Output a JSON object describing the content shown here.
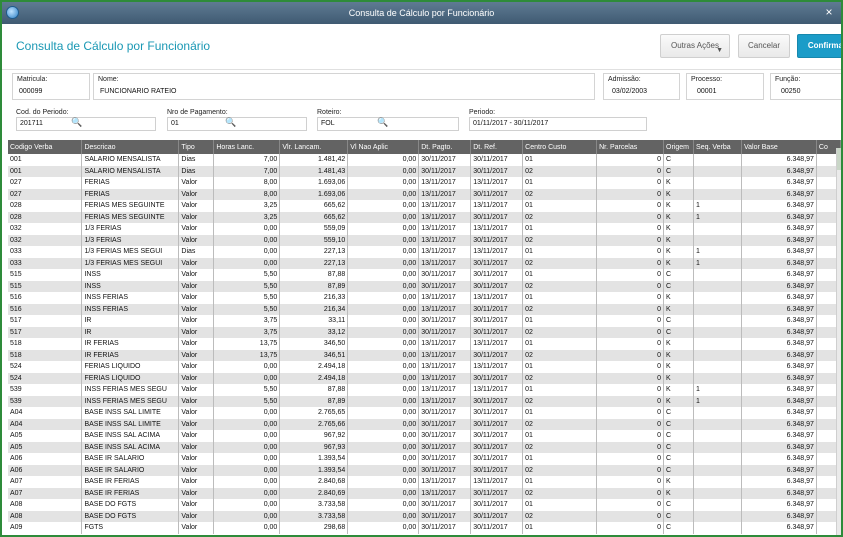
{
  "window": {
    "title": "Consulta de Cálculo por Funcionário"
  },
  "header": {
    "title": "Consulta de Cálculo por Funcionário",
    "buttons": {
      "outras": "Outras Ações",
      "cancelar": "Cancelar",
      "confirmar": "Confirmar"
    }
  },
  "employee": {
    "matricula": {
      "label": "Matricula:",
      "value": "000099"
    },
    "nome": {
      "label": "Nome:",
      "value": "FUNCIONARIO RATEIO"
    },
    "admissao": {
      "label": "Admissão:",
      "value": "03/02/2003"
    },
    "processo": {
      "label": "Processo:",
      "value": "00001"
    },
    "funcao": {
      "label": "Função:",
      "value": "00250"
    }
  },
  "filters": {
    "cod_periodo": {
      "label": "Cod. do Periodo:",
      "value": "201711"
    },
    "nro_pagamento": {
      "label": "Nro de Pagamento:",
      "value": "01"
    },
    "roteiro": {
      "label": "Roteiro:",
      "value": "FOL"
    },
    "periodo": {
      "label": "Periodo:",
      "value": "01/11/2017 - 30/11/2017"
    }
  },
  "table": {
    "columns": [
      "Codigo Verba",
      "Descricao",
      "Tipo",
      "Horas Lanc.",
      "Vlr. Lancam.",
      "Vl Nao Aplic",
      "Dt. Pagto.",
      "Dt. Ref.",
      "Centro Custo",
      "Nr. Parcelas",
      "Origem",
      "Seq. Verba",
      "Valor Base",
      "Co"
    ],
    "rows": [
      [
        "001",
        "SALARIO MENSALISTA",
        "Dias",
        "7,00",
        "1.481,42",
        "0,00",
        "30/11/2017",
        "30/11/2017",
        "01",
        "0",
        "C",
        "",
        "6.348,97"
      ],
      [
        "001",
        "SALARIO MENSALISTA",
        "Dias",
        "7,00",
        "1.481,43",
        "0,00",
        "30/11/2017",
        "30/11/2017",
        "02",
        "0",
        "C",
        "",
        "6.348,97"
      ],
      [
        "027",
        "FERIAS",
        "Valor",
        "8,00",
        "1.693,06",
        "0,00",
        "13/11/2017",
        "13/11/2017",
        "01",
        "0",
        "K",
        "",
        "6.348,97"
      ],
      [
        "027",
        "FERIAS",
        "Valor",
        "8,00",
        "1.693,06",
        "0,00",
        "13/11/2017",
        "30/11/2017",
        "02",
        "0",
        "K",
        "",
        "6.348,97"
      ],
      [
        "028",
        "FERIAS MES SEGUINTE",
        "Valor",
        "3,25",
        "665,62",
        "0,00",
        "13/11/2017",
        "13/11/2017",
        "01",
        "0",
        "K",
        "1",
        "6.348,97"
      ],
      [
        "028",
        "FERIAS MES SEGUINTE",
        "Valor",
        "3,25",
        "665,62",
        "0,00",
        "13/11/2017",
        "30/11/2017",
        "02",
        "0",
        "K",
        "1",
        "6.348,97"
      ],
      [
        "032",
        "1/3 FERIAS",
        "Valor",
        "0,00",
        "559,09",
        "0,00",
        "13/11/2017",
        "13/11/2017",
        "01",
        "0",
        "K",
        "",
        "6.348,97"
      ],
      [
        "032",
        "1/3 FERIAS",
        "Valor",
        "0,00",
        "559,10",
        "0,00",
        "13/11/2017",
        "30/11/2017",
        "02",
        "0",
        "K",
        "",
        "6.348,97"
      ],
      [
        "033",
        "1/3 FERIAS MES SEGUI",
        "Dias",
        "0,00",
        "227,13",
        "0,00",
        "13/11/2017",
        "13/11/2017",
        "01",
        "0",
        "K",
        "1",
        "6.348,97"
      ],
      [
        "033",
        "1/3 FERIAS MES SEGUI",
        "Valor",
        "0,00",
        "227,13",
        "0,00",
        "13/11/2017",
        "30/11/2017",
        "02",
        "0",
        "K",
        "1",
        "6.348,97"
      ],
      [
        "515",
        "INSS",
        "Valor",
        "5,50",
        "87,88",
        "0,00",
        "30/11/2017",
        "30/11/2017",
        "01",
        "0",
        "C",
        "",
        "6.348,97"
      ],
      [
        "515",
        "INSS",
        "Valor",
        "5,50",
        "87,89",
        "0,00",
        "30/11/2017",
        "30/11/2017",
        "02",
        "0",
        "C",
        "",
        "6.348,97"
      ],
      [
        "516",
        "INSS FERIAS",
        "Valor",
        "5,50",
        "216,33",
        "0,00",
        "13/11/2017",
        "13/11/2017",
        "01",
        "0",
        "K",
        "",
        "6.348,97"
      ],
      [
        "516",
        "INSS FERIAS",
        "Valor",
        "5,50",
        "216,34",
        "0,00",
        "13/11/2017",
        "30/11/2017",
        "02",
        "0",
        "K",
        "",
        "6.348,97"
      ],
      [
        "517",
        "IR",
        "Valor",
        "3,75",
        "33,11",
        "0,00",
        "30/11/2017",
        "30/11/2017",
        "01",
        "0",
        "C",
        "",
        "6.348,97"
      ],
      [
        "517",
        "IR",
        "Valor",
        "3,75",
        "33,12",
        "0,00",
        "30/11/2017",
        "30/11/2017",
        "02",
        "0",
        "C",
        "",
        "6.348,97"
      ],
      [
        "518",
        "IR FERIAS",
        "Valor",
        "13,75",
        "346,50",
        "0,00",
        "13/11/2017",
        "13/11/2017",
        "01",
        "0",
        "K",
        "",
        "6.348,97"
      ],
      [
        "518",
        "IR FERIAS",
        "Valor",
        "13,75",
        "346,51",
        "0,00",
        "13/11/2017",
        "30/11/2017",
        "02",
        "0",
        "K",
        "",
        "6.348,97"
      ],
      [
        "524",
        "FERIAS LIQUIDO",
        "Valor",
        "0,00",
        "2.494,18",
        "0,00",
        "13/11/2017",
        "13/11/2017",
        "01",
        "0",
        "K",
        "",
        "6.348,97"
      ],
      [
        "524",
        "FERIAS LIQUIDO",
        "Valor",
        "0,00",
        "2.494,18",
        "0,00",
        "13/11/2017",
        "30/11/2017",
        "02",
        "0",
        "K",
        "",
        "6.348,97"
      ],
      [
        "539",
        "INSS FERIAS MES SEGU",
        "Valor",
        "5,50",
        "87,88",
        "0,00",
        "13/11/2017",
        "13/11/2017",
        "01",
        "0",
        "K",
        "1",
        "6.348,97"
      ],
      [
        "539",
        "INSS FERIAS MES SEGU",
        "Valor",
        "5,50",
        "87,89",
        "0,00",
        "13/11/2017",
        "30/11/2017",
        "02",
        "0",
        "K",
        "1",
        "6.348,97"
      ],
      [
        "A04",
        "BASE INSS SAL LIMITE",
        "Valor",
        "0,00",
        "2.765,65",
        "0,00",
        "30/11/2017",
        "30/11/2017",
        "01",
        "0",
        "C",
        "",
        "6.348,97"
      ],
      [
        "A04",
        "BASE INSS SAL LIMITE",
        "Valor",
        "0,00",
        "2.765,66",
        "0,00",
        "30/11/2017",
        "30/11/2017",
        "02",
        "0",
        "C",
        "",
        "6.348,97"
      ],
      [
        "A05",
        "BASE INSS SAL ACIMA",
        "Valor",
        "0,00",
        "967,92",
        "0,00",
        "30/11/2017",
        "30/11/2017",
        "01",
        "0",
        "C",
        "",
        "6.348,97"
      ],
      [
        "A05",
        "BASE INSS SAL ACIMA",
        "Valor",
        "0,00",
        "967,93",
        "0,00",
        "30/11/2017",
        "30/11/2017",
        "02",
        "0",
        "C",
        "",
        "6.348,97"
      ],
      [
        "A06",
        "BASE IR SALARIO",
        "Valor",
        "0,00",
        "1.393,54",
        "0,00",
        "30/11/2017",
        "30/11/2017",
        "01",
        "0",
        "C",
        "",
        "6.348,97"
      ],
      [
        "A06",
        "BASE IR SALARIO",
        "Valor",
        "0,00",
        "1.393,54",
        "0,00",
        "30/11/2017",
        "30/11/2017",
        "02",
        "0",
        "C",
        "",
        "6.348,97"
      ],
      [
        "A07",
        "BASE IR FERIAS",
        "Valor",
        "0,00",
        "2.840,68",
        "0,00",
        "13/11/2017",
        "13/11/2017",
        "01",
        "0",
        "K",
        "",
        "6.348,97"
      ],
      [
        "A07",
        "BASE IR FERIAS",
        "Valor",
        "0,00",
        "2.840,69",
        "0,00",
        "13/11/2017",
        "30/11/2017",
        "02",
        "0",
        "K",
        "",
        "6.348,97"
      ],
      [
        "A08",
        "BASE DO FGTS",
        "Valor",
        "0,00",
        "3.733,58",
        "0,00",
        "30/11/2017",
        "30/11/2017",
        "01",
        "0",
        "C",
        "",
        "6.348,97"
      ],
      [
        "A08",
        "BASE DO FGTS",
        "Valor",
        "0,00",
        "3.733,58",
        "0,00",
        "30/11/2017",
        "30/11/2017",
        "02",
        "0",
        "C",
        "",
        "6.348,97"
      ],
      [
        "A09",
        "FGTS",
        "Valor",
        "0,00",
        "298,68",
        "0,00",
        "30/11/2017",
        "30/11/2017",
        "01",
        "0",
        "C",
        "",
        "6.348,97"
      ]
    ]
  },
  "icons": {
    "search": "search-icon",
    "app": "app-logo-icon"
  }
}
